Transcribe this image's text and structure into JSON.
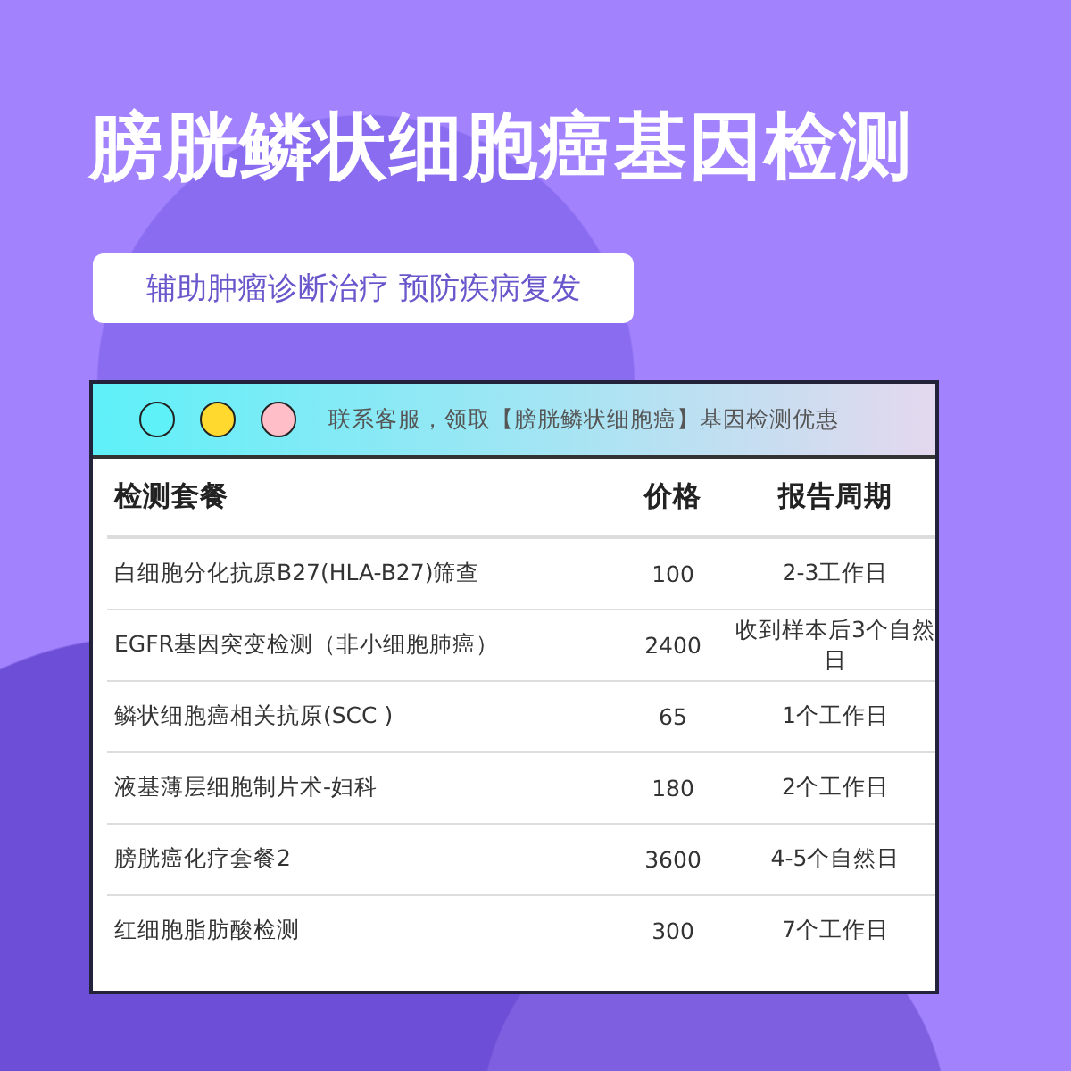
{
  "title": "膀胱鳞状细胞癌基因检测",
  "subtitle": "辅助肿瘤诊断治疗 预防疾病复发",
  "window": {
    "dots": [
      {
        "color": "#5ef2f8"
      },
      {
        "color": "#ffd92e"
      },
      {
        "color": "#ffbec8"
      }
    ],
    "notice": "联系客服，领取【膀胱鳞状细胞癌】基因检测优惠"
  },
  "table": {
    "columns": [
      "检测套餐",
      "价格",
      "报告周期"
    ],
    "rows": [
      [
        "白细胞分化抗原B27(HLA-B27)筛查",
        "100",
        "2-3工作日"
      ],
      [
        "EGFR基因突变检测（非小细胞肺癌）",
        "2400",
        "收到样本后3个自然日"
      ],
      [
        "鳞状细胞癌相关抗原(SCC )",
        "65",
        "1个工作日"
      ],
      [
        "液基薄层细胞制片术-妇科",
        "180",
        "2个工作日"
      ],
      [
        "膀胱癌化疗套餐2",
        "3600",
        "4-5个自然日"
      ],
      [
        "红细胞脂肪酸检测",
        "300",
        "7个工作日"
      ]
    ]
  }
}
